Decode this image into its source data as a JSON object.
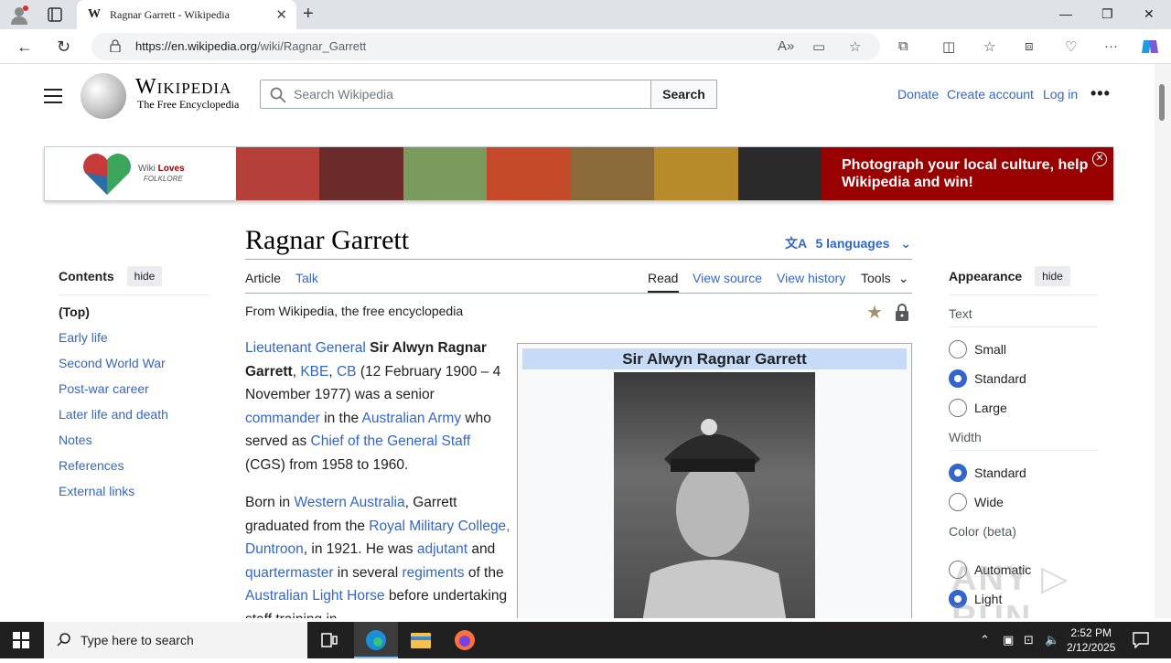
{
  "browser": {
    "tab_title": "Ragnar Garrett - Wikipedia",
    "tab_favicon": "W",
    "url_domain": "https://en.wikipedia.org",
    "url_path": "/wiki/Ragnar_Garrett"
  },
  "header": {
    "logo_word": "Wikipedia",
    "logo_tagline": "The Free Encyclopedia",
    "search_placeholder": "Search Wikipedia",
    "search_button": "Search",
    "donate": "Donate",
    "create_account": "Create account",
    "login": "Log in"
  },
  "banner": {
    "wiki": "Wiki",
    "loves": "Loves",
    "folklore": "FOLKLORE",
    "cta": "Photograph your local culture, help Wikipedia and win!"
  },
  "toc": {
    "title": "Contents",
    "hide": "hide",
    "items": [
      "(Top)",
      "Early life",
      "Second World War",
      "Post-war career",
      "Later life and death",
      "Notes",
      "References",
      "External links"
    ]
  },
  "article": {
    "title": "Ragnar Garrett",
    "languages": "5 languages",
    "tab_article": "Article",
    "tab_talk": "Talk",
    "tab_read": "Read",
    "tab_view_source": "View source",
    "tab_view_history": "View history",
    "tab_tools": "Tools",
    "from": "From Wikipedia, the free encyclopedia",
    "p1": {
      "link1": "Lieutenant General",
      "name": "Sir Alwyn Ragnar Garrett",
      "link2": "KBE",
      "link3": "CB",
      "t1": "(12 February 1900 – 4 November 1977) was a senior",
      "link4": "commander",
      "t2": "in the",
      "link5": "Australian Army",
      "t3": "who served as",
      "link6": "Chief of the General Staff",
      "t4": "(CGS) from 1958 to 1960."
    },
    "p2": {
      "t1": "Born in",
      "link1": "Western Australia",
      "t2": ", Garrett graduated from the",
      "link2": "Royal Military College, Duntroon",
      "t3": ", in 1921. He was",
      "link3": "adjutant",
      "t4": "and",
      "link4": "quartermaster",
      "t5": "in several",
      "link5": "regiments",
      "t6": "of the",
      "link6": "Australian Light Horse",
      "t7": "before undertaking staff training in"
    },
    "infobox_title": "Sir Alwyn Ragnar Garrett"
  },
  "appearance": {
    "title": "Appearance",
    "hide": "hide",
    "text_label": "Text",
    "text_options": [
      "Small",
      "Standard",
      "Large"
    ],
    "text_selected": "Standard",
    "width_label": "Width",
    "width_options": [
      "Standard",
      "Wide"
    ],
    "width_selected": "Standard",
    "color_label": "Color (beta)",
    "color_options": [
      "Automatic",
      "Light"
    ],
    "color_selected": "Light"
  },
  "taskbar": {
    "search_placeholder": "Type here to search",
    "time": "2:52 PM",
    "date": "2/12/2025"
  },
  "colors": {
    "link": "#3366cc",
    "banner_red": "#990000",
    "infobox_header": "#c6dbf7"
  }
}
